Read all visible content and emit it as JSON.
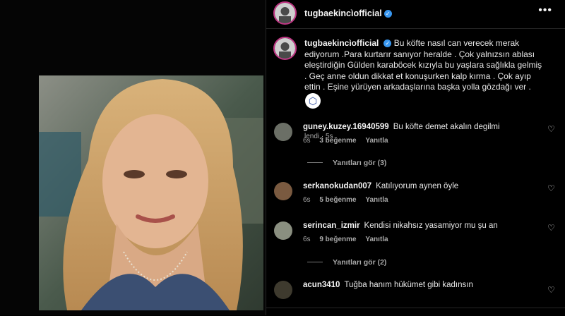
{
  "post": {
    "username": "tugbaekincìofficial",
    "more_icon": "•••",
    "caption": "Bu köfte nasıl can verecek merak ediyorum .Para kurtarır sanıyor heralde . Çok yalnızsın ablası eleştirdiğin Gülden karaböcek kızıyla bu yaşlara sağlıkla gelmiş . Geç anne oldun dikkat et konuşurken kalp kırma . Çok ayıp ettin . Eşine yürüyen arkadaşlarına başka yolla gözdağı ver .",
    "caption_meta": "lendi · 5s"
  },
  "comments": [
    {
      "username": "guney.kuzey.16940599",
      "text": "Bu köfte demet akalın degilmi",
      "time": "6s",
      "likes": "3 beğenme",
      "reply": "Yanıtla",
      "view_replies": "Yanıtları gör (3)"
    },
    {
      "username": "serkanokudan007",
      "text": "Katılıyorum aynen öyle",
      "time": "6s",
      "likes": "5 beğenme",
      "reply": "Yanıtla"
    },
    {
      "username": "serincan_izmir",
      "text": "Kendisi nikahsız yasamiyor mu şu an",
      "time": "6s",
      "likes": "9 beğenme",
      "reply": "Yanıtla",
      "view_replies": "Yanıtları gör (2)"
    },
    {
      "username": "acun3410",
      "text": "Tuğba hanım hükümet gibi kadınsın"
    }
  ],
  "icons": {
    "verified": "verified-badge-icon",
    "heart": "heart-icon",
    "more": "more-options-icon",
    "translate": "translate-badge-icon"
  },
  "colors": {
    "background": "#000000",
    "verified": "#3897f0",
    "ring": "#c13584",
    "muted": "#a8a8a8"
  }
}
